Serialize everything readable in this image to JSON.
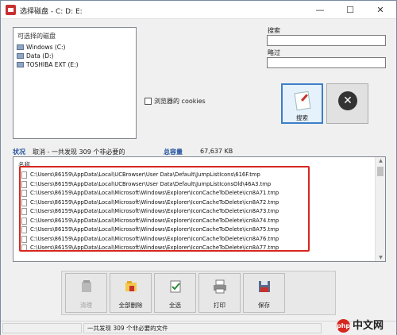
{
  "window": {
    "title": "选择磁盘 - C: D: E:",
    "min_glyph": "—",
    "max_glyph": "☐",
    "close_glyph": "✕"
  },
  "drives": {
    "header": "可选择的磁盘",
    "items": [
      "Windows (C:)",
      "Data (D:)",
      "TOSHIBA EXT (E:)"
    ]
  },
  "options": {
    "cookies_label": "浏览器的 cookies",
    "cookies_checked": false
  },
  "search": {
    "label": "搜索",
    "skip_label": "略过",
    "search_value": "",
    "skip_value": "",
    "search_button": "搜索",
    "stop_glyph": "✕"
  },
  "status": {
    "state_label": "状况",
    "state_text": "取消 - 一共发现 309 个非必要的",
    "total_label": "总容量",
    "total_value": "67,637 KB"
  },
  "results": {
    "column_header": "名称",
    "rows": [
      "C:\\Users\\86159\\AppData\\Local\\UCBrowser\\User Data\\Default\\JumpListIcons\\616F.tmp",
      "C:\\Users\\86159\\AppData\\Local\\UCBrowser\\User Data\\Default\\JumpListIconsOld\\46A3.tmp",
      "C:\\Users\\86159\\AppData\\Local\\Microsoft\\Windows\\Explorer\\IconCacheToDelete\\icn8A71.tmp",
      "C:\\Users\\86159\\AppData\\Local\\Microsoft\\Windows\\Explorer\\IconCacheToDelete\\icn8A72.tmp",
      "C:\\Users\\86159\\AppData\\Local\\Microsoft\\Windows\\Explorer\\IconCacheToDelete\\icn8A73.tmp",
      "C:\\Users\\86159\\AppData\\Local\\Microsoft\\Windows\\Explorer\\IconCacheToDelete\\icn8A74.tmp",
      "C:\\Users\\86159\\AppData\\Local\\Microsoft\\Windows\\Explorer\\IconCacheToDelete\\icn8A75.tmp",
      "C:\\Users\\86159\\AppData\\Local\\Microsoft\\Windows\\Explorer\\IconCacheToDelete\\icn8A76.tmp",
      "C:\\Users\\86159\\AppData\\Local\\Microsoft\\Windows\\Explorer\\IconCacheToDelete\\icn8A77.tmp"
    ]
  },
  "toolbar": {
    "clean_label": "清理",
    "delete_all_label": "全部删除",
    "select_all_label": "全选",
    "print_label": "打印",
    "save_label": "保存"
  },
  "statusbar": {
    "text": "一共发现 309 个非必要的文件"
  },
  "watermark": {
    "logo": "php",
    "site": "中文网"
  },
  "colors": {
    "highlight_border": "#d7261e",
    "accent_blue": "#1f4e9c",
    "search_button_border": "#3c7fc9"
  }
}
